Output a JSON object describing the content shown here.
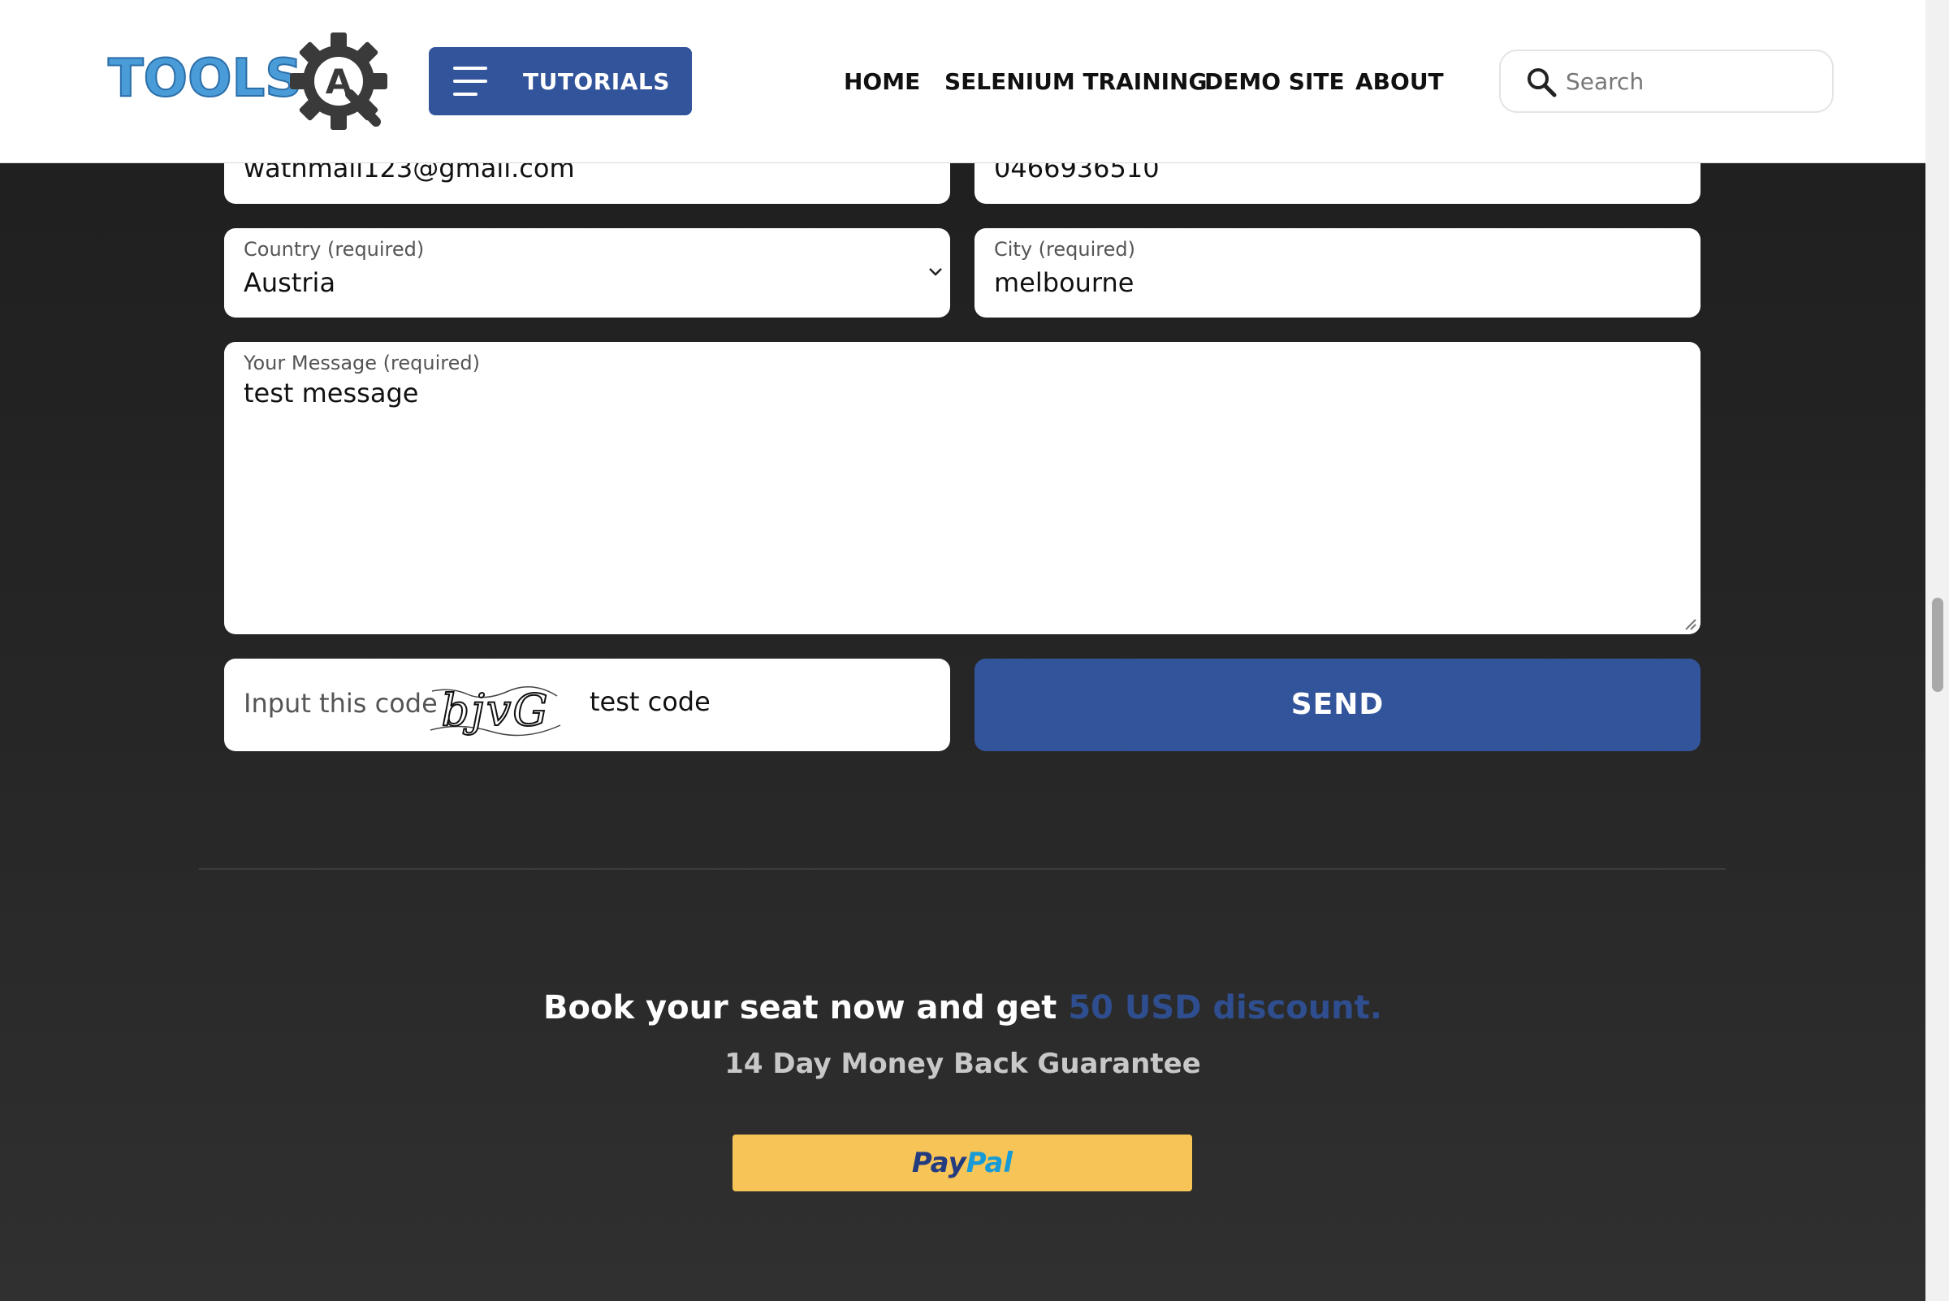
{
  "header": {
    "logo_text": "TOOLS",
    "logo_badge": "A",
    "tutorials_label": "TUTORIALS",
    "nav": [
      "HOME",
      "SELENIUM TRAINING",
      "DEMO SITE",
      "ABOUT"
    ],
    "search_placeholder": "Search"
  },
  "form": {
    "email_value": "wathmail123@gmail.com",
    "phone_value": "0466936510",
    "country_label": "Country (required)",
    "country_value": "Austria",
    "city_label": "City (required)",
    "city_value": "melbourne",
    "message_label": "Your Message (required)",
    "message_value": "test message",
    "captcha_label": "Input this code",
    "captcha_image_text": "bjvG",
    "captcha_value": "test code",
    "send_label": "SEND"
  },
  "promo": {
    "main_text": "Book your seat now and get ",
    "highlight_text": "50 USD discount.",
    "sub_text": "14 Day Money Back Guarantee",
    "paypal_part1": "Pay",
    "paypal_part2": "Pal"
  },
  "colors": {
    "accent": "#32549b",
    "paypal_yellow": "#f7c557",
    "logo_blue": "#4a9cd8"
  }
}
